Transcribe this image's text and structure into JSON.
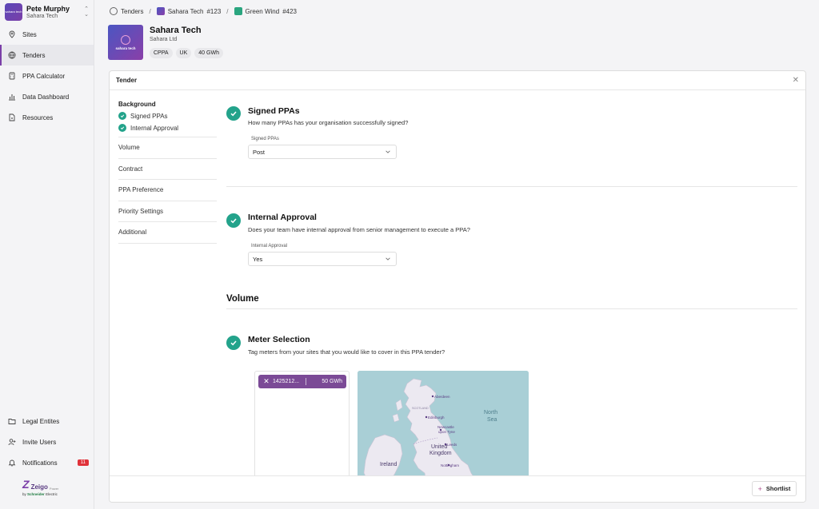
{
  "user": {
    "name": "Pete Murphy",
    "org": "Sahara Tech",
    "avatar_text": "sahara tech"
  },
  "nav": {
    "items": [
      {
        "label": "Sites",
        "icon": "map-pin-icon"
      },
      {
        "label": "Tenders",
        "icon": "globe-icon",
        "active": true
      },
      {
        "label": "PPA Calculator",
        "icon": "calculator-icon"
      },
      {
        "label": "Data Dashboard",
        "icon": "bar-chart-icon"
      },
      {
        "label": "Resources",
        "icon": "document-icon"
      }
    ],
    "bottom_items": [
      {
        "label": "Legal Entites",
        "icon": "folder-icon"
      },
      {
        "label": "Invite Users",
        "icon": "user-plus-icon"
      },
      {
        "label": "Notifications",
        "icon": "bell-icon",
        "badge": "11"
      }
    ]
  },
  "brand": {
    "name": "Zeigo",
    "suffix": "Power",
    "by": "by",
    "company": "Schneider",
    "company_suffix": "Electric"
  },
  "breadcrumb": {
    "root": "Tenders",
    "org": "Sahara Tech",
    "org_num": "#123",
    "project": "Green Wind",
    "project_num": "#423"
  },
  "company": {
    "name": "Sahara Tech",
    "legal": "Sahara Ltd",
    "logo_text": "sahara tech",
    "tags": [
      "CPPA",
      "UK",
      "40 GWh"
    ]
  },
  "panel": {
    "title": "Tender",
    "shortlist_label": "Shortlist"
  },
  "steps": {
    "background": "Background",
    "substeps": [
      "Signed PPAs",
      "Internal Approval"
    ],
    "items": [
      "Volume",
      "Contract",
      "PPA Preference",
      "Priority Settings",
      "Additional"
    ]
  },
  "signed_ppas": {
    "title": "Signed PPAs",
    "question": "How many PPAs has your organisation successfully signed?",
    "field_label": "Signed PPAs",
    "value": "Post"
  },
  "internal_approval": {
    "title": "Internal Approval",
    "question": "Does your team have internal approval from senior management to execute a PPA?",
    "field_label": "Internal Approval",
    "value": "Yes"
  },
  "volume": {
    "title": "Volume"
  },
  "meter_selection": {
    "title": "Meter Selection",
    "question": "Tag meters from your sites that you would like to cover in this PPA tender?",
    "chip_id": "1425212...",
    "chip_volume": "50 GWh"
  },
  "map_labels": {
    "north_sea_1": "North",
    "north_sea_2": "Sea",
    "uk_1": "United",
    "uk_2": "Kingdom",
    "ireland": "Ireland",
    "scotland": "SCOTLAND",
    "aberdeen": "Aberdeen",
    "edinburgh": "Edinburgh",
    "newcastle_1": "Newcastle",
    "newcastle_2": "upon Tyne",
    "leeds": "Leeds",
    "nottingham": "Nottingham"
  },
  "colors": {
    "accent": "#7b3fa8",
    "check": "#23a38b",
    "badge": "#e0323a",
    "map_water": "#a9cfd6",
    "map_land": "#ece9f1"
  }
}
